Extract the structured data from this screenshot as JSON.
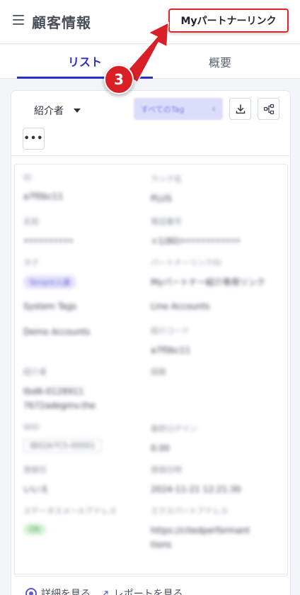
{
  "header": {
    "title": "顧客情報",
    "partner_link_label": "Myパートナーリンク"
  },
  "tabs": [
    {
      "label": "リスト",
      "active": true
    },
    {
      "label": "概要",
      "active": false
    }
  ],
  "annotation": {
    "step": "3",
    "color": "#d92027"
  },
  "toolbar": {
    "filter_label": "紹介者",
    "search_placeholder": "すべてのTag",
    "download_icon": "download-icon",
    "share_icon": "share-nodes-icon",
    "more_label": "•••"
  },
  "detail_blurred": {
    "fields": [
      {
        "label": "ID",
        "value": "a7f0bc11"
      },
      {
        "label": "ランク名",
        "value": "PLUS"
      },
      {
        "label": "名前",
        "value": "••••••••••"
      },
      {
        "label": "電話番号",
        "value": "+1(80)••••••••••••"
      },
      {
        "label": "タグ",
        "value": "Tenant入庫"
      },
      {
        "label": "パートナーリンクID",
        "value": "Myパートナー紹介専用リンク"
      },
      {
        "label": "System Tags",
        "value": "Line Accounts"
      },
      {
        "label": "Demo Accounts",
        "value": ""
      },
      {
        "label": "紹介コード",
        "value": "a7f0bc11"
      },
      {
        "label": "紹介者",
        "value": "tbd6-0128911  7672adegmv.the"
      },
      {
        "label": "国籍",
        "value": ""
      },
      {
        "label": "WID",
        "value": "IB02A7C5-00001"
      },
      {
        "label": "最終ログイン",
        "value": "0.00"
      },
      {
        "label": "登録日",
        "value": "いいえ"
      },
      {
        "label": "登録日時",
        "value": "2024-11-21 12:21:30"
      },
      {
        "label": "ステータスメールアドレス",
        "value": "OK"
      },
      {
        "label": "エクスパートアドレス",
        "value": "https://citedperformanttions"
      }
    ]
  },
  "footer": {
    "view_details_label": "詳細を見る",
    "view_report_label": "レポートを見る"
  }
}
